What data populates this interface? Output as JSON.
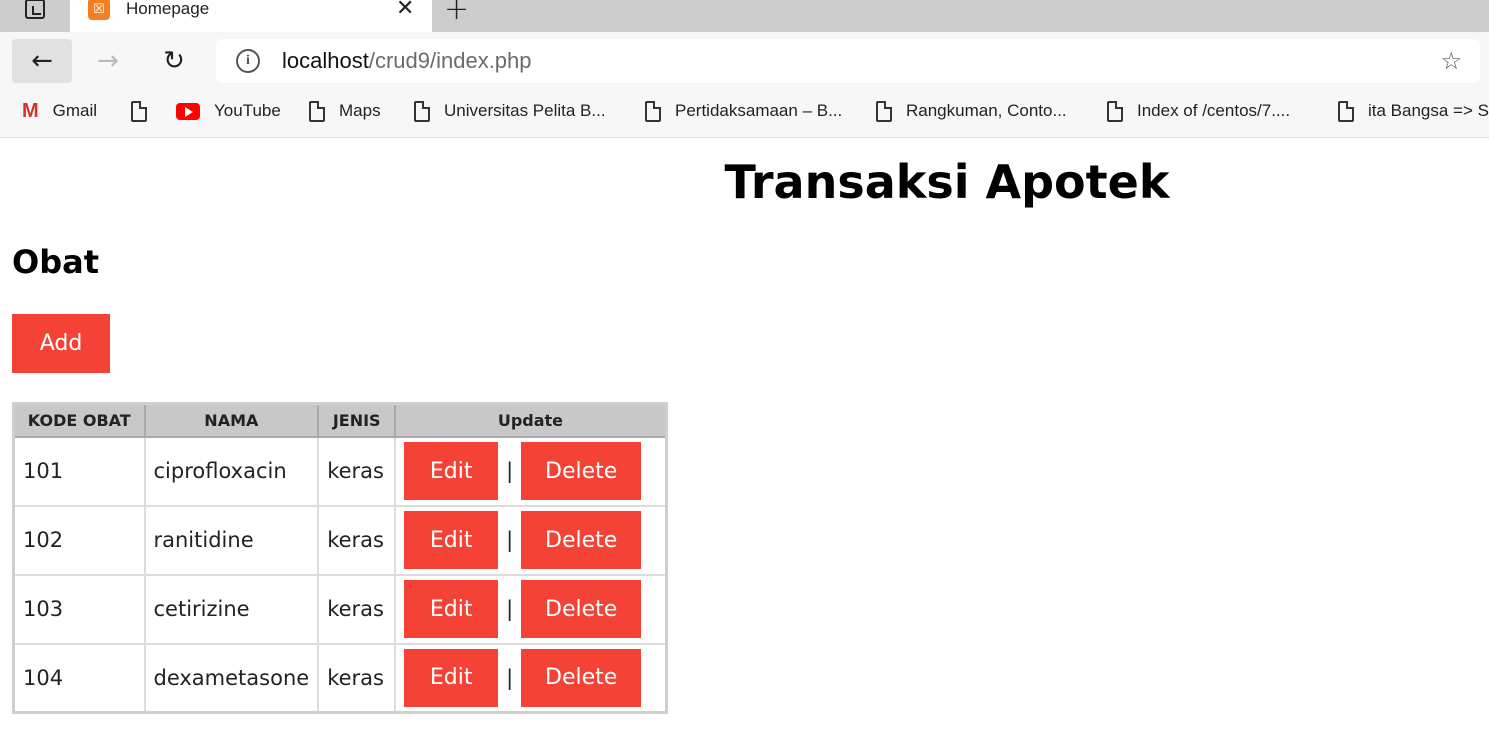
{
  "browser": {
    "tab_title": "Homepage",
    "tab_favicon": "xampp-icon",
    "new_tab_symbol": "+",
    "close_symbol": "✕",
    "url_host": "localhost",
    "url_path": "/crud9/index.php",
    "bookmarks": [
      {
        "label": "Gmail",
        "icon": "gmail-icon"
      },
      {
        "label": "",
        "icon": "page-icon"
      },
      {
        "label": "YouTube",
        "icon": "youtube-icon"
      },
      {
        "label": "Maps",
        "icon": "page-icon"
      },
      {
        "label": "Universitas Pelita B...",
        "icon": "page-icon"
      },
      {
        "label": "Pertidaksamaan – B...",
        "icon": "page-icon"
      },
      {
        "label": "Rangkuman, Conto...",
        "icon": "page-icon"
      },
      {
        "label": "Index of /centos/7....",
        "icon": "page-icon"
      },
      {
        "label": "ita Bangsa => S",
        "icon": "page-icon"
      }
    ]
  },
  "page": {
    "title": "Transaksi Apotek",
    "section": "Obat",
    "add_label": "Add",
    "accent_color": "#f44336",
    "table": {
      "headers": [
        "KODE OBAT",
        "NAMA",
        "JENIS",
        "Update"
      ],
      "edit_label": "Edit",
      "delete_label": "Delete",
      "separator": "|",
      "rows": [
        {
          "kode": "101",
          "nama": "ciprofloxacin",
          "jenis": "keras"
        },
        {
          "kode": "102",
          "nama": "ranitidine",
          "jenis": "keras"
        },
        {
          "kode": "103",
          "nama": "cetirizine",
          "jenis": "keras"
        },
        {
          "kode": "104",
          "nama": "dexametasone",
          "jenis": "keras"
        }
      ]
    }
  }
}
